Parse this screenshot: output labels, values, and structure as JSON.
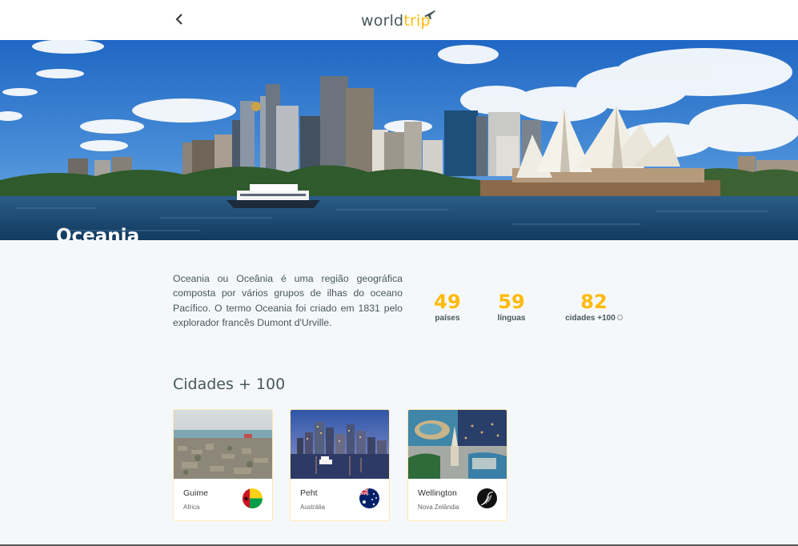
{
  "header": {
    "logo_main": "world",
    "logo_accent": "trip"
  },
  "hero": {
    "title": "Oceania"
  },
  "continent": {
    "description": "Oceania ou Oceânia é uma região geográfica composta por vários grupos de ilhas do oceano Pacífico. O termo Oceania foi criado em 1831 pelo explorador francês Dumont d'Urville.",
    "stats": [
      {
        "value": "49",
        "label": "países"
      },
      {
        "value": "59",
        "label": "línguas"
      },
      {
        "value": "82",
        "label": "cidades +100"
      }
    ]
  },
  "cities_section": {
    "title": "Cidades + 100",
    "cities": [
      {
        "name": "Guime",
        "country": "Africa",
        "flag": "guinea-bissau-flag"
      },
      {
        "name": "Peht",
        "country": "Austrália",
        "flag": "australia-flag"
      },
      {
        "name": "Wellington",
        "country": "Nova Zelândia",
        "flag": "new-zealand-flag"
      }
    ]
  },
  "colors": {
    "accent": "#ffba08",
    "text": "#47585b",
    "background": "#f5f8fa"
  }
}
